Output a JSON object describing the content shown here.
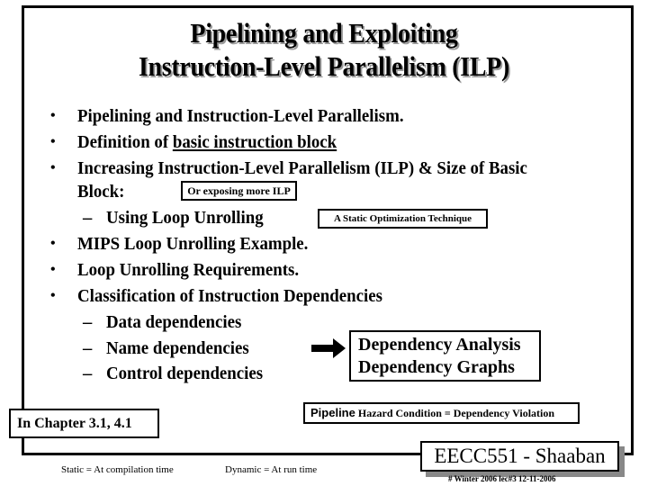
{
  "slide": {
    "title_line1": "Pipelining and Exploiting",
    "title_line2": "Instruction-Level Parallelism (ILP)",
    "bullets": [
      {
        "marker": "•",
        "text": "Pipelining and Instruction-Level Parallelism."
      },
      {
        "marker": "•",
        "prefix": "Definition of ",
        "underlined": "basic instruction block"
      },
      {
        "marker": "•",
        "text": "Increasing Instruction-Level Parallelism (ILP) & Size of Basic",
        "continuation": "Block:"
      },
      {
        "marker": "–",
        "text": "Using Loop Unrolling"
      },
      {
        "marker": "•",
        "text": "MIPS Loop Unrolling Example."
      },
      {
        "marker": "•",
        "text": "Loop Unrolling Requirements."
      },
      {
        "marker": "•",
        "text": "Classification of Instruction Dependencies"
      },
      {
        "marker": "–",
        "text": "Data dependencies"
      },
      {
        "marker": "–",
        "text": "Name dependencies"
      },
      {
        "marker": "–",
        "text": "Control dependencies"
      }
    ],
    "notes": {
      "exposing_ilp": "Or exposing more ILP",
      "static_technique": "A Static Optimization Technique",
      "dependency_line1": "Dependency Analysis",
      "dependency_line2": "Dependency Graphs",
      "pipeline_word": "Pipeline",
      "hazard_text": " Hazard Condition = Dependency Violation",
      "chapter": "In  Chapter 3.1, 4.1"
    },
    "arrow_icon": "right-arrow-icon",
    "course_label": "EECC551 - Shaaban",
    "footer": {
      "static_def": "Static = At compilation time",
      "dynamic_def": "Dynamic  =  At run time",
      "slide_info": "# Winter 2006 lec#3   12-11-2006"
    }
  }
}
